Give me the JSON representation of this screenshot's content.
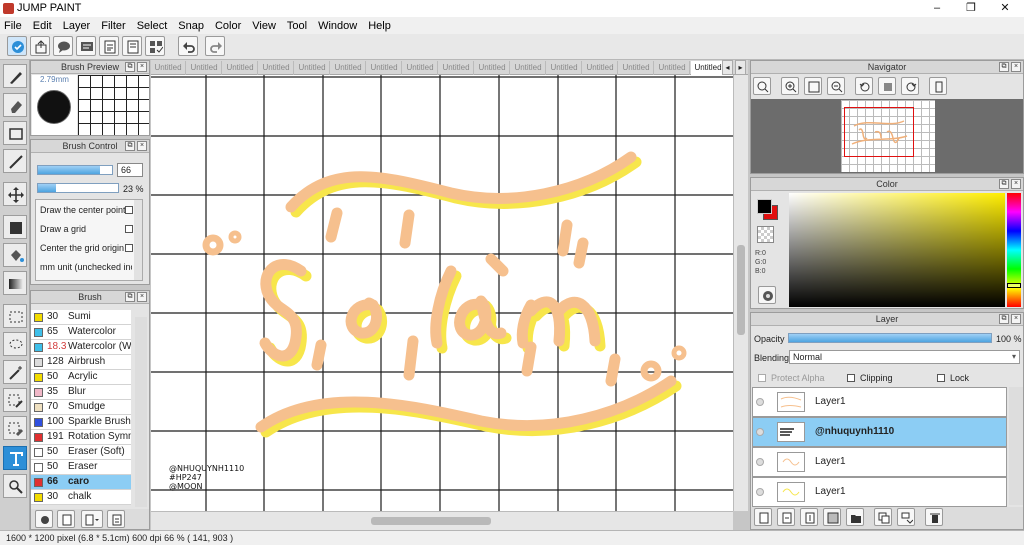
{
  "window": {
    "title": "JUMP PAINT",
    "controls": [
      "–",
      "❐",
      "✕"
    ]
  },
  "menu": [
    "File",
    "Edit",
    "Layer",
    "Filter",
    "Select",
    "Snap",
    "Color",
    "View",
    "Tool",
    "Window",
    "Help"
  ],
  "brush_preview": {
    "title": "Brush Preview",
    "size_label": "2.79mm"
  },
  "brush_control": {
    "title": "Brush Control",
    "size_value": "66",
    "size_fill": 0.84,
    "opacity_value": "23 %",
    "opacity_fill": 0.23,
    "options": [
      "Draw the center point",
      "Draw a grid",
      "Center the grid origin",
      "mm unit (unchecked inch"
    ]
  },
  "brush": {
    "title": "Brush",
    "items": [
      {
        "size": "30",
        "name": "Sumi",
        "color": "#f3dc00"
      },
      {
        "size": "65",
        "name": "Watercolor",
        "color": "#3fc0ea"
      },
      {
        "size": "18.3",
        "name": "Watercolor (We",
        "color": "#3fc0ea",
        "size_color": "#d23c3c"
      },
      {
        "size": "128",
        "name": "Airbrush",
        "color": "#dcdcdc"
      },
      {
        "size": "50",
        "name": "Acrylic",
        "color": "#f3dc00"
      },
      {
        "size": "35",
        "name": "Blur",
        "color": "#f1b8c8"
      },
      {
        "size": "70",
        "name": "Smudge",
        "color": "#efe0c0"
      },
      {
        "size": "100",
        "name": "Sparkle Brush",
        "color": "#3050e0"
      },
      {
        "size": "191",
        "name": "Rotation Symme",
        "color": "#e03030"
      },
      {
        "size": "50",
        "name": "Eraser (Soft)",
        "color": "#ffffff"
      },
      {
        "size": "50",
        "name": "Eraser",
        "color": "#ffffff"
      },
      {
        "size": "66",
        "name": "caro",
        "color": "#e03030",
        "selected": true
      },
      {
        "size": "30",
        "name": "chalk",
        "color": "#f3dc00"
      }
    ]
  },
  "canvas": {
    "tab_label": "Untitled",
    "tab_count": 16,
    "lettering_watermark": [
      "Sợ Làm"
    ],
    "signature_lines": [
      "@NHUQUYNH1110",
      "#HP247",
      "@MOON"
    ]
  },
  "navigator": {
    "title": "Navigator"
  },
  "color": {
    "title": "Color",
    "foreground": "#000000",
    "background": "#e01010",
    "r_label": "R:0",
    "g_label": "G:0",
    "b_label": "B:0"
  },
  "layer": {
    "title": "Layer",
    "opacity_label": "Opacity",
    "opacity_value": "100 %",
    "opacity_fill": 1.0,
    "blending_label": "Blending",
    "blending_value": "Normal",
    "protect_alpha": "Protect Alpha",
    "clipping": "Clipping",
    "lock": "Lock",
    "layers": [
      {
        "name": "Layer1",
        "selected": false
      },
      {
        "name": "@nhuquynh1110",
        "selected": true
      },
      {
        "name": "Layer1",
        "selected": false
      },
      {
        "name": "Layer1",
        "selected": false
      }
    ]
  },
  "status": {
    "text": "1600 * 1200 pixel   (6.8 * 5.1cm)   600 dpi   66 %   ( 141, 903 )"
  },
  "colors": {
    "accent": "#2d8fd8",
    "lettering_peach": "#f6c08e",
    "lettering_shadow": "#f7e64b",
    "grid_line": "#1c1c1c"
  }
}
